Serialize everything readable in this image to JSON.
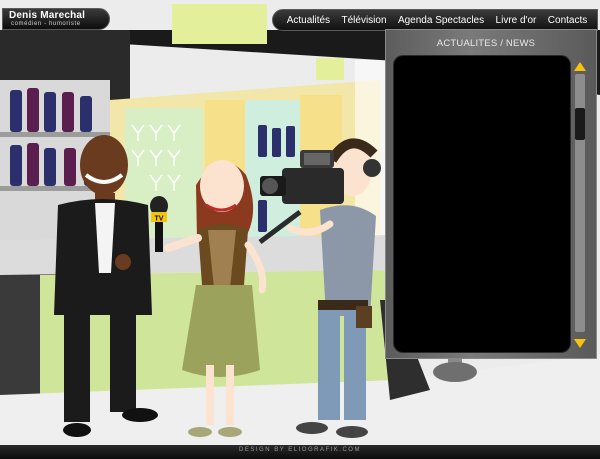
{
  "brand": {
    "name": "Denis Marechal",
    "subtitle": "comédien - humoriste"
  },
  "nav": {
    "items": [
      {
        "label": "Actualités"
      },
      {
        "label": "Télévision"
      },
      {
        "label": "Agenda Spectacles"
      },
      {
        "label": "Livre d'or"
      },
      {
        "label": "Contacts"
      }
    ]
  },
  "news": {
    "title": "ACTUALITES / NEWS",
    "content": ""
  },
  "illustration": {
    "microphone_label": "TV"
  },
  "footer": {
    "credit": "DESIGN BY ELIOGRAFIK.COM"
  },
  "colors": {
    "accent": "#f4c40e",
    "panel": "#6b6b6b",
    "screen": "#000000",
    "bar_wall": "#f2e6a8"
  }
}
